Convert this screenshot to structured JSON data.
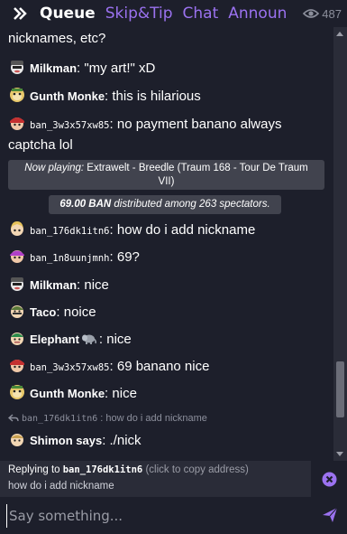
{
  "header": {
    "tabs": [
      {
        "label": "Queue",
        "active": true
      },
      {
        "label": "Skip&Tip",
        "active": false
      },
      {
        "label": "Chat",
        "active": false
      },
      {
        "label": "Announ",
        "active": false
      }
    ],
    "viewer_count": "487"
  },
  "colors": {
    "background": "#1d1f2b",
    "accent": "#9b72f0",
    "notice_bg": "#41434e"
  },
  "chat": {
    "first_line": "nicknames, etc?",
    "messages": [
      {
        "name": "Milkman",
        "sep": ": ",
        "text": "\"my art!\" xD",
        "avatar": "milkman-avatar"
      },
      {
        "name": "Gunth Monke",
        "sep": ": ",
        "text": "this is hilarious",
        "avatar": "monkey-avatar"
      },
      {
        "name": "ban_3w3x57xw85",
        "sep": ": ",
        "text": "no payment banano always",
        "text2": "captcha lol",
        "avatar": "red-avatar"
      },
      {
        "name": "ban_176dk1itn6",
        "sep": ": ",
        "text": "how do i add nickname",
        "avatar": "blonde-avatar"
      },
      {
        "name": "ban_1n8uunjmnh",
        "sep": ": ",
        "text": "69?",
        "avatar": "purple-avatar"
      },
      {
        "name": "Milkman",
        "sep": ": ",
        "text": "nice",
        "avatar": "milkman-avatar"
      },
      {
        "name": "Taco",
        "sep": ": ",
        "text": "noice",
        "avatar": "taco-avatar"
      },
      {
        "name": "Elephant",
        "sep": ": ",
        "text": "nice",
        "avatar": "elephant-avatar"
      },
      {
        "name": "ban_3w3x57xw85",
        "sep": ": ",
        "text": "69 banano nice",
        "avatar": "red-avatar"
      },
      {
        "name": "Gunth Monke",
        "sep": ": ",
        "text": "nice",
        "avatar": "monkey-avatar"
      },
      {
        "name": "Shimon says",
        "sep": ": ",
        "text": "./nick",
        "avatar": "shimon-avatar"
      }
    ],
    "now_playing": {
      "prefix": "Now playing:",
      "track_line1": " Extrawelt - Breedle (Traum 168 - Tour De Traum",
      "track_line2": "VII)"
    },
    "distribution": {
      "amount": "69.00 BAN",
      "text": " distributed among 263 spectators."
    },
    "reply_reference": {
      "name": "ban_176dk1itn6",
      "text": ": how do i add nickname"
    }
  },
  "reply_bar": {
    "prefix": "Replying to ",
    "target": "ban_176dk1itn6",
    "hint": " (click to copy address)",
    "quoted": "how do i add nickname"
  },
  "input": {
    "placeholder": "Say something..."
  }
}
